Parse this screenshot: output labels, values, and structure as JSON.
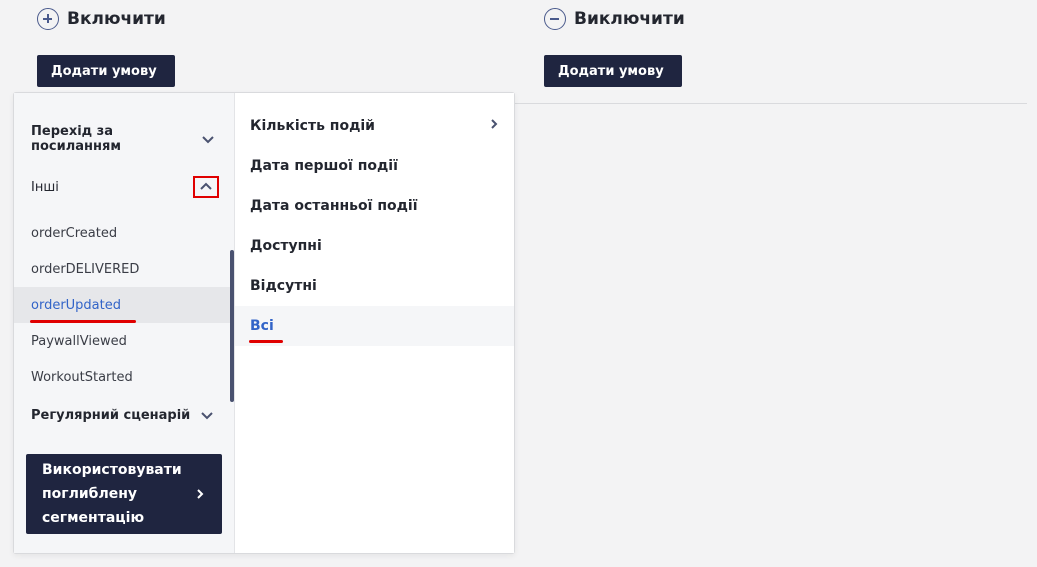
{
  "include": {
    "title": "Включити",
    "add_label": "Додати умову"
  },
  "exclude": {
    "title": "Виключити",
    "add_label": "Додати умову"
  },
  "left": {
    "groups": [
      {
        "label": "Перехід за посиланням",
        "expanded": false
      },
      {
        "label": "Інші",
        "expanded": true
      },
      {
        "label": "Регулярний сценарій",
        "expanded": false
      }
    ],
    "events": [
      "orderCreated",
      "orderDELIVERED",
      "orderUpdated",
      "PaywallViewed",
      "WorkoutStarted"
    ],
    "selected_event": "orderUpdated",
    "advanced_label": "Використовувати поглиблену сегментацію"
  },
  "right": {
    "options": [
      "Кількість подій",
      "Дата першої події",
      "Дата останньої події",
      "Доступні",
      "Відсутні",
      "Всі"
    ],
    "selected_option": "Всі"
  },
  "colors": {
    "accent_dark": "#1f2540",
    "selected_text": "#3264c8",
    "annotation_red": "#e00000"
  },
  "icons": [
    "plus-circle-icon",
    "minus-circle-icon",
    "chevron-down-icon",
    "chevron-up-icon",
    "chevron-right-icon"
  ]
}
